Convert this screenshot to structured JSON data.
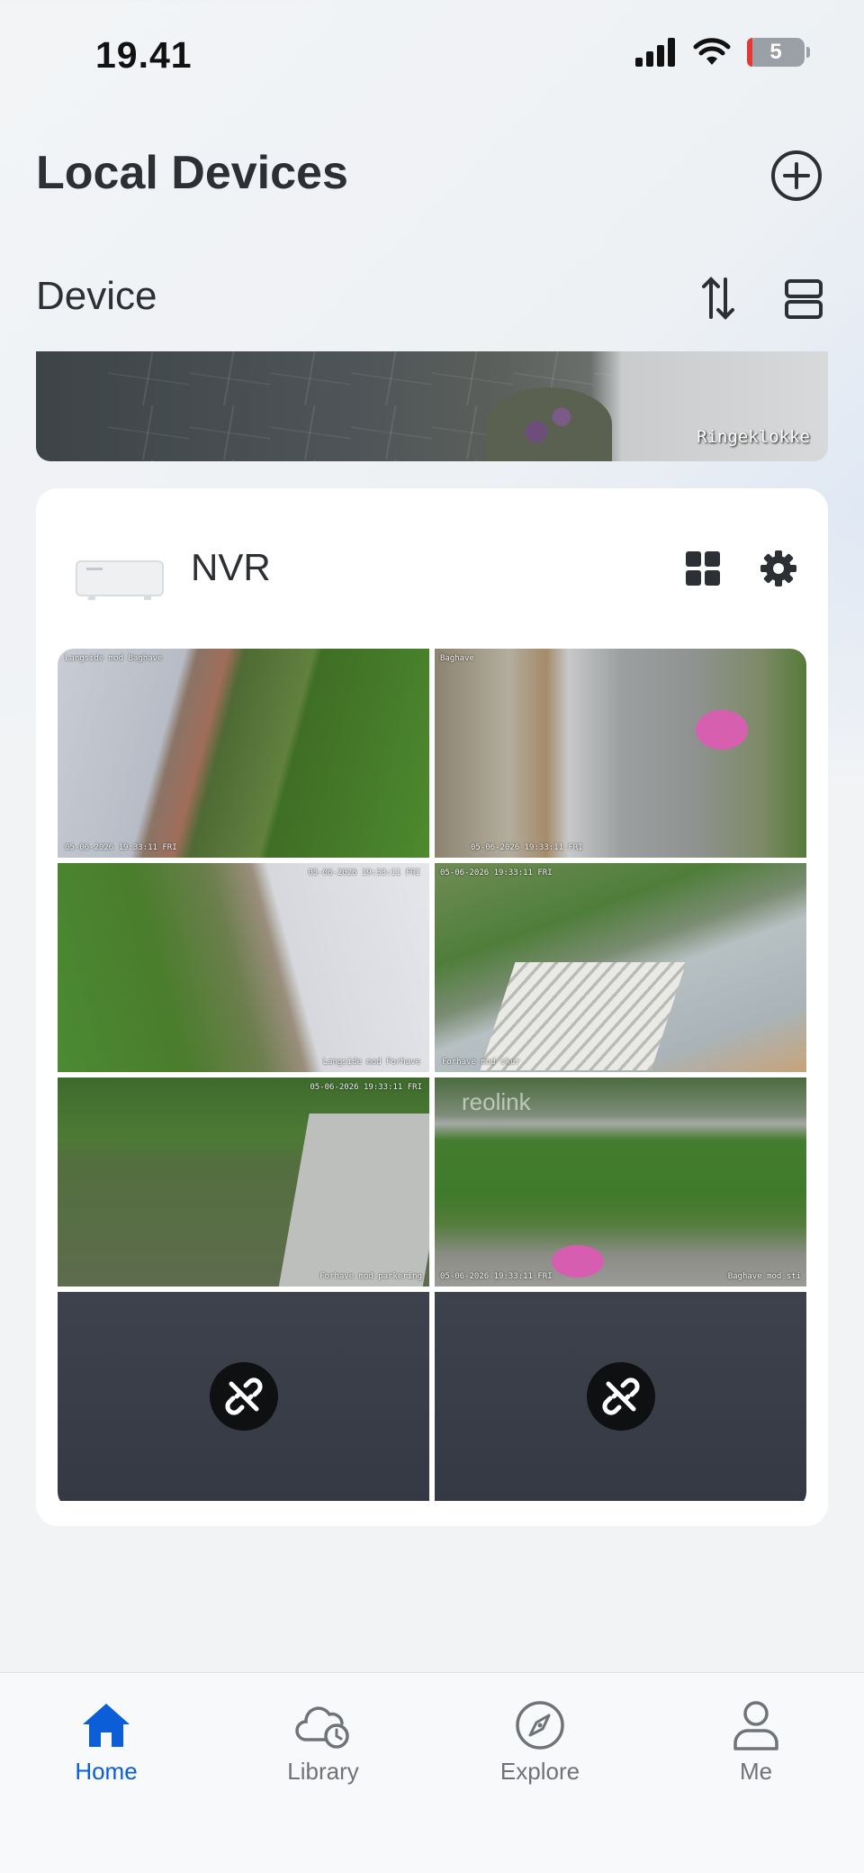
{
  "status_bar": {
    "time": "19.41",
    "battery": "5"
  },
  "header": {
    "title": "Local Devices"
  },
  "section": {
    "title": "Device"
  },
  "doorbell": {
    "camera_name": "Ringeklokke"
  },
  "nvr": {
    "name": "NVR",
    "cameras": [
      {
        "label": "Langside mod Baghave",
        "timestamp": "05-06-2026 19:33:11 FRI",
        "status": "live"
      },
      {
        "label": "Baghave",
        "timestamp": "05-06-2026 19:33:11 FRI",
        "status": "live"
      },
      {
        "label": "Langside mod Forhave",
        "timestamp": "05-06-2026 19:33:11 FRI",
        "status": "live"
      },
      {
        "label": "Forhave mod skur",
        "timestamp": "05-06-2026 19:33:11 FRI",
        "status": "live"
      },
      {
        "label": "Forhave mod parkering",
        "timestamp": "05-06-2026 19:33:11 FRI",
        "status": "live"
      },
      {
        "label": "Baghave mod sti",
        "timestamp": "05-06-2026 19:33:11 FRI",
        "brand": "reolink",
        "status": "live"
      },
      {
        "status": "offline"
      },
      {
        "status": "offline"
      }
    ]
  },
  "tabs": [
    {
      "label": "Home",
      "icon": "home-icon",
      "active": true
    },
    {
      "label": "Library",
      "icon": "cloud-clock-icon",
      "active": false
    },
    {
      "label": "Explore",
      "icon": "compass-icon",
      "active": false
    },
    {
      "label": "Me",
      "icon": "person-icon",
      "active": false
    }
  ],
  "colors": {
    "accent": "#0b5ed7",
    "text": "#2c2f33",
    "offline_tile": "#3b4049"
  }
}
